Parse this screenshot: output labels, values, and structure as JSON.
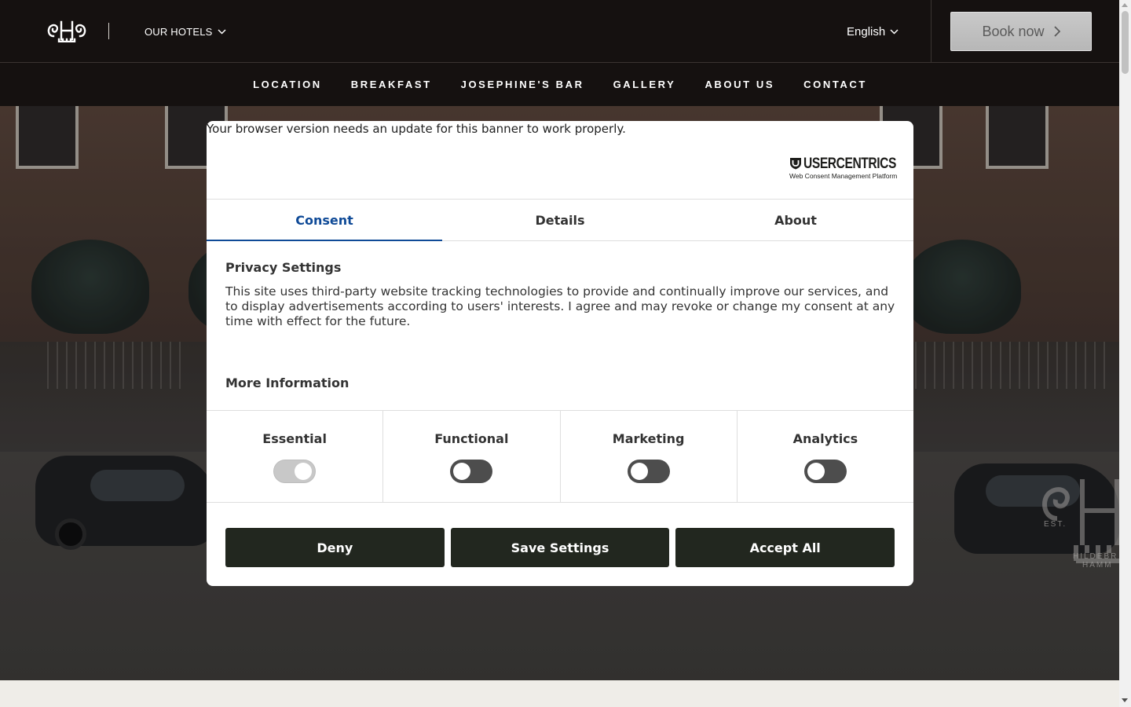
{
  "header": {
    "hotels_label": "OUR HOTELS",
    "language_label": "English",
    "book_label": "Book now"
  },
  "nav": {
    "items": [
      {
        "label": "LOCATION"
      },
      {
        "label": "BREAKFAST"
      },
      {
        "label": "JOSEPHINE'S BAR"
      },
      {
        "label": "GALLERY"
      },
      {
        "label": "ABOUT US"
      },
      {
        "label": "CONTACT"
      }
    ]
  },
  "hero": {
    "mark_est": "EST.",
    "mark_name_line1": "HILDEBR",
    "mark_name_line2": "HAMM"
  },
  "consent": {
    "update_note": "Your browser version needs an update for this banner to work properly.",
    "brand_name": "USERCENTRICS",
    "brand_sub": "Web Consent Management Platform",
    "tabs": [
      {
        "label": "Consent",
        "active": true
      },
      {
        "label": "Details",
        "active": false
      },
      {
        "label": "About",
        "active": false
      }
    ],
    "privacy_title": "Privacy Settings",
    "privacy_body": "This site uses third-party website tracking technologies to provide and continually improve our services, and to display advertisements according to users' interests. I agree and may revoke or change my consent at any time with effect for the future.",
    "more_info": "More Information",
    "categories": [
      {
        "label": "Essential",
        "enabled": true,
        "locked": true
      },
      {
        "label": "Functional",
        "enabled": false,
        "locked": false
      },
      {
        "label": "Marketing",
        "enabled": false,
        "locked": false
      },
      {
        "label": "Analytics",
        "enabled": false,
        "locked": false
      }
    ],
    "buttons": {
      "deny": "Deny",
      "save": "Save Settings",
      "accept": "Accept All"
    }
  },
  "colors": {
    "header_bg": "#151110",
    "tab_active": "#0f4a97",
    "button_bg": "#22271f"
  }
}
